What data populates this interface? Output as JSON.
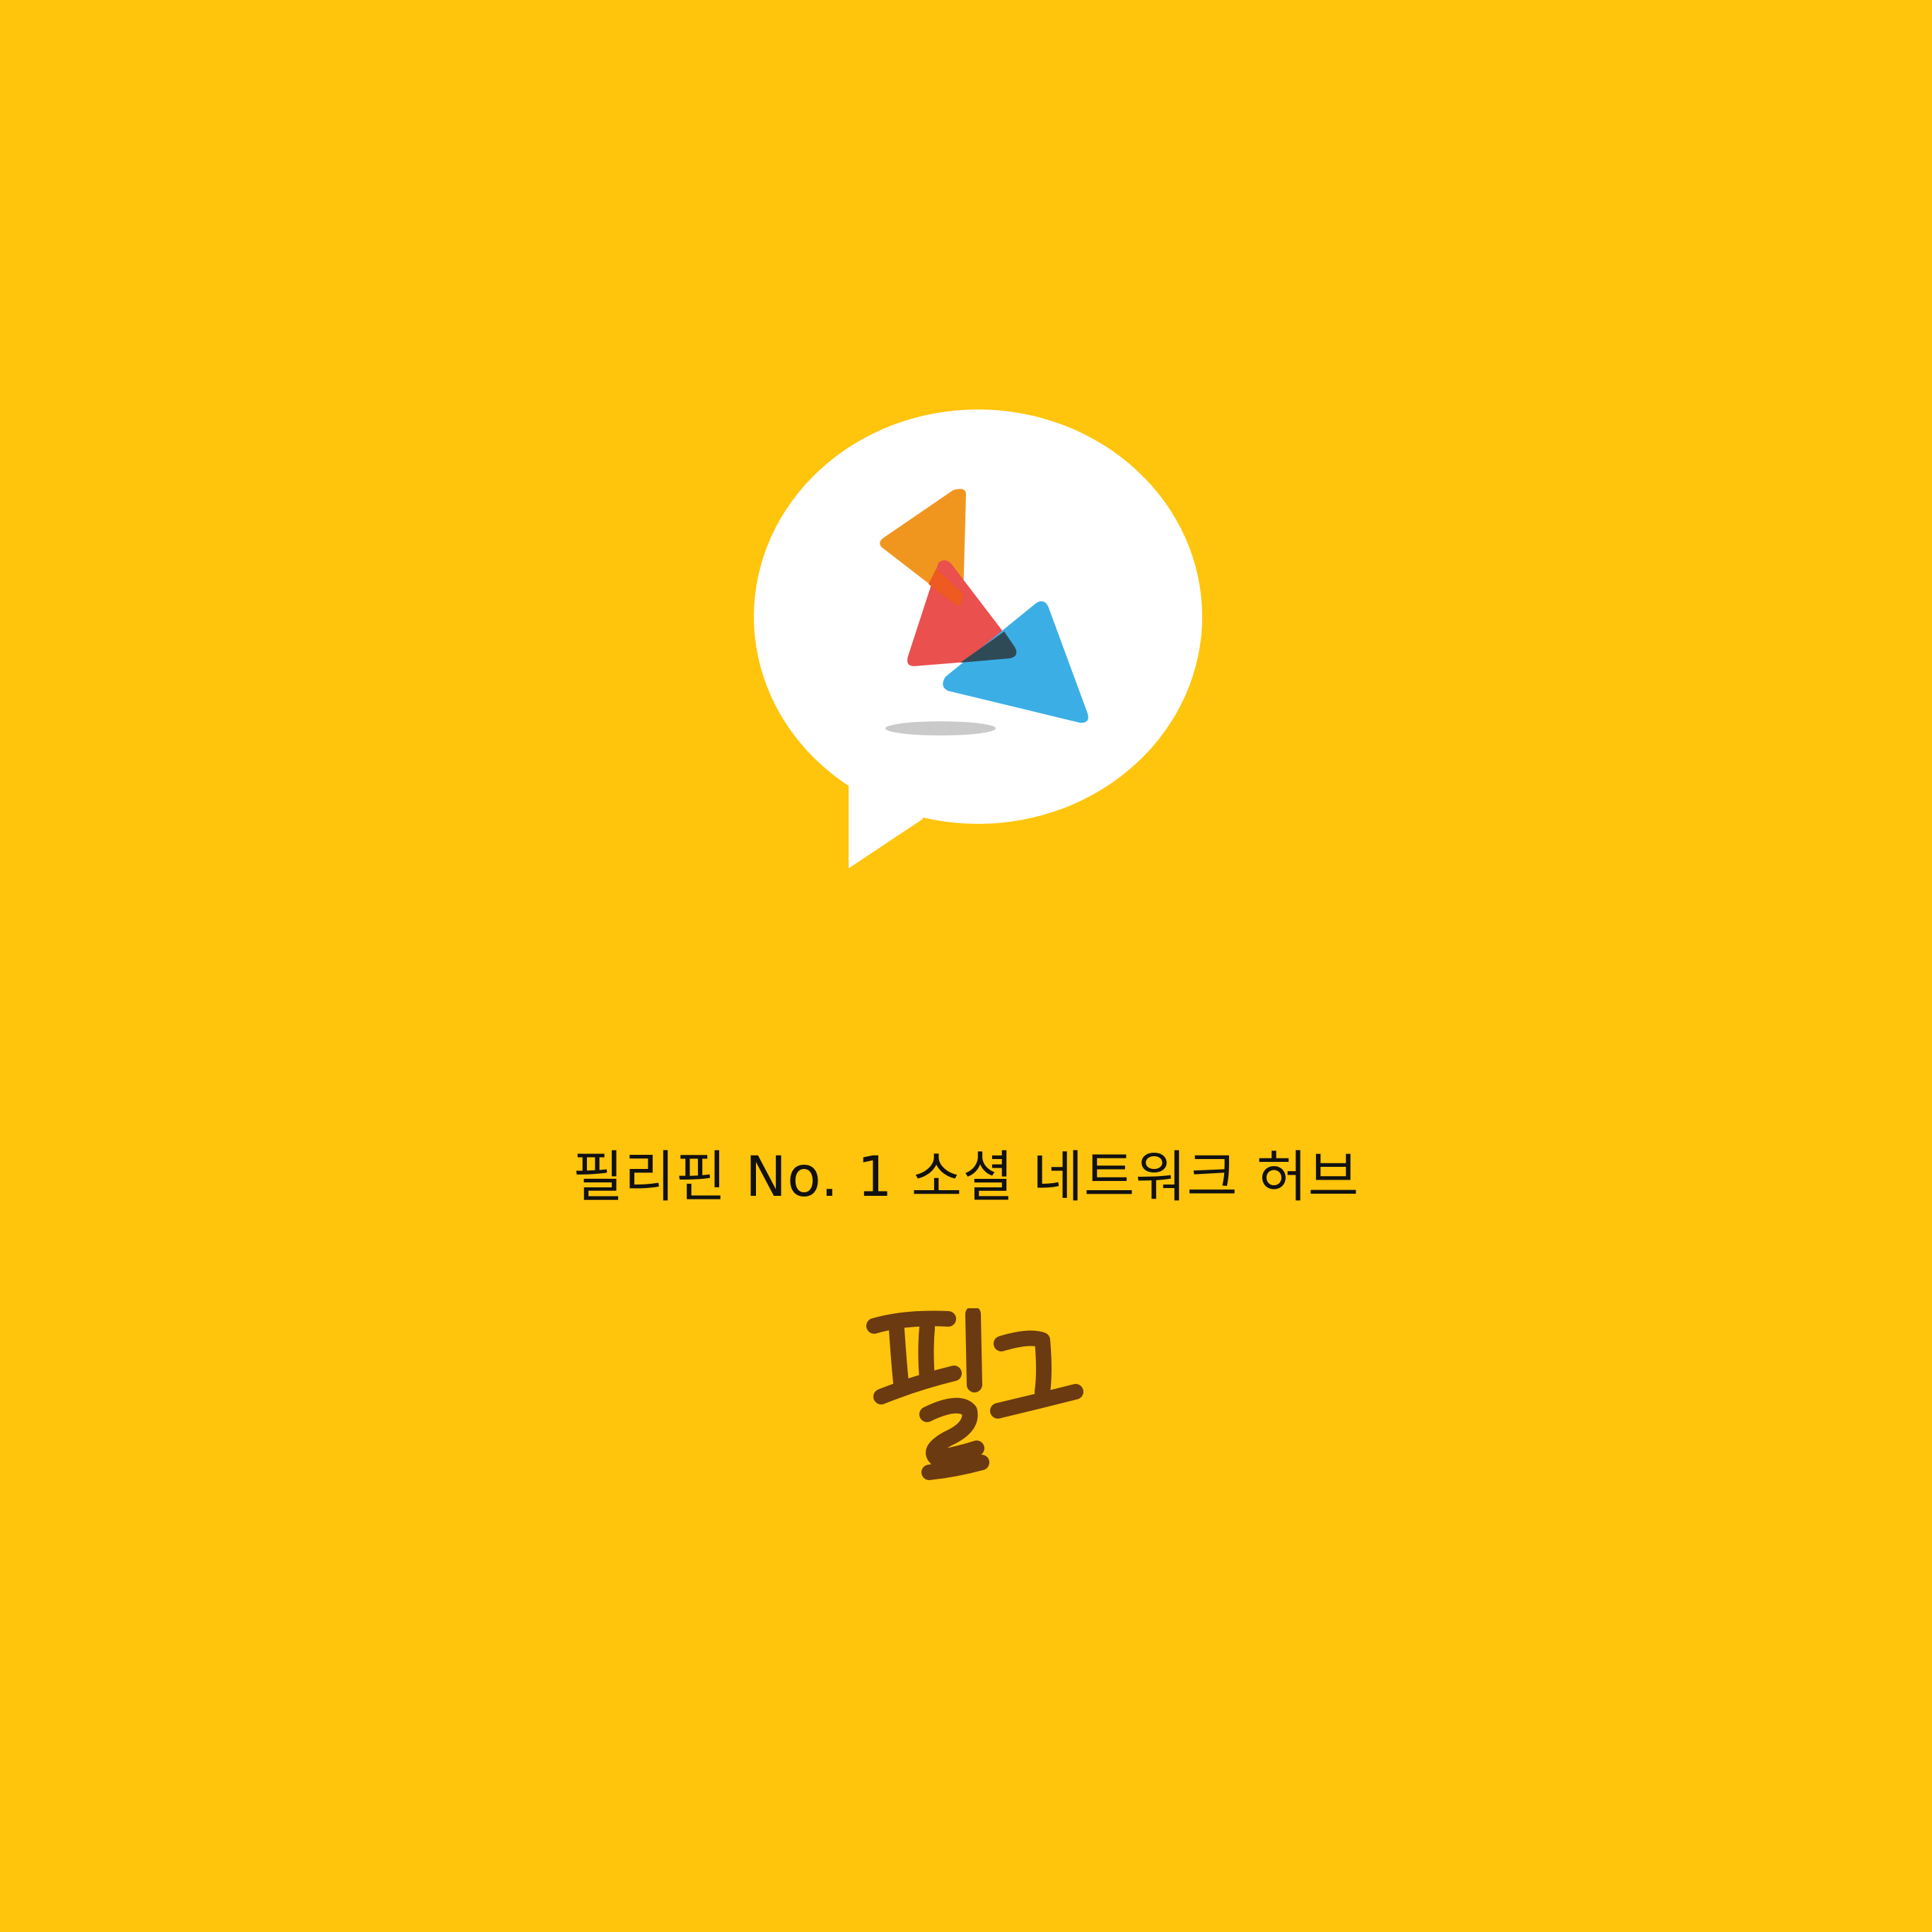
{
  "app": {
    "tagline": "필리핀 No. 1 소셜 네트워크 허브",
    "wordmark": "필고"
  },
  "logo": {
    "bubble_icon": "speech-bubble-icon",
    "triangles": [
      "orange-triangle-icon",
      "red-triangle-icon",
      "blue-triangle-icon"
    ]
  },
  "colors": {
    "background": "#FFC40C",
    "bubble": "#FFFFFF",
    "orange": "#F0961E",
    "red": "#E9504E",
    "blue": "#3BAEE6",
    "overlap_orange_red": "#EE5A1F",
    "overlap_red_blue": "#2F4A57",
    "wordmark": "#6B3A10",
    "tagline": "#111111"
  }
}
